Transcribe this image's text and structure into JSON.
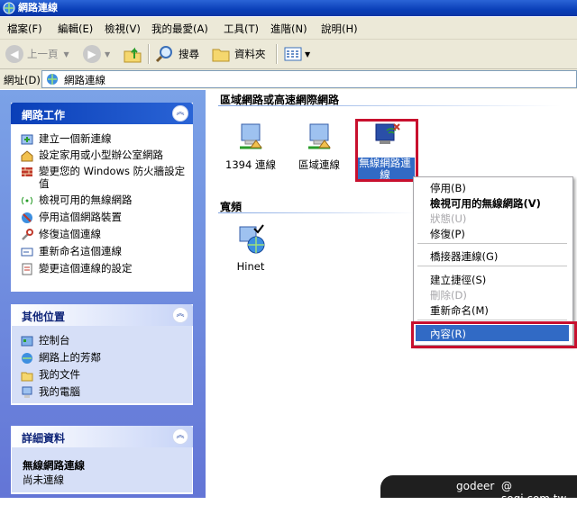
{
  "window": {
    "title": "網路連線"
  },
  "menubar": [
    "檔案(F)",
    "編輯(E)",
    "檢視(V)",
    "我的最愛(A)",
    "工具(T)",
    "進階(N)",
    "說明(H)"
  ],
  "toolbar": {
    "back": "上一頁",
    "search": "搜尋",
    "folders": "資料夾"
  },
  "address": {
    "label": "網址(D)",
    "value": "網路連線"
  },
  "sidebar": {
    "network_tasks": {
      "title": "網路工作",
      "items": [
        "建立一個新連線",
        "設定家用或小型辦公室網路",
        "變更您的 Windows 防火牆設定值",
        "檢視可用的無線網路",
        "停用這個網路裝置",
        "修復這個連線",
        "重新命名這個連線",
        "變更這個連線的設定"
      ]
    },
    "other_places": {
      "title": "其他位置",
      "items": [
        "控制台",
        "網路上的芳鄰",
        "我的文件",
        "我的電腦"
      ]
    },
    "details": {
      "title": "詳細資料",
      "name": "無線網路連線",
      "status": "尚未連線"
    }
  },
  "content": {
    "group_lan": "區域網路或高速網際網路",
    "lan_items": [
      "1394 連線",
      "區域連線",
      "無線網路連線"
    ],
    "group_broadband": "寬頻",
    "broadband_items": [
      "Hinet"
    ]
  },
  "context_menu": {
    "items": [
      {
        "label": "停用(B)",
        "state": "normal"
      },
      {
        "label": "檢視可用的無線網路(V)",
        "state": "bold"
      },
      {
        "label": "狀態(U)",
        "state": "disabled"
      },
      {
        "label": "修復(P)",
        "state": "normal"
      },
      {
        "label": "橋接器連線(G)",
        "state": "normal"
      },
      {
        "label": "建立捷徑(S)",
        "state": "normal"
      },
      {
        "label": "刪除(D)",
        "state": "disabled"
      },
      {
        "label": "重新命名(M)",
        "state": "normal"
      },
      {
        "label": "內容(R)",
        "state": "highlighted"
      }
    ]
  },
  "watermark": {
    "user": "godeer",
    "site": "@ sogi.com.tw"
  },
  "colors": {
    "highlight": "#316ac5",
    "annotation": "#c8102e",
    "task_pane": "#6375d6"
  }
}
